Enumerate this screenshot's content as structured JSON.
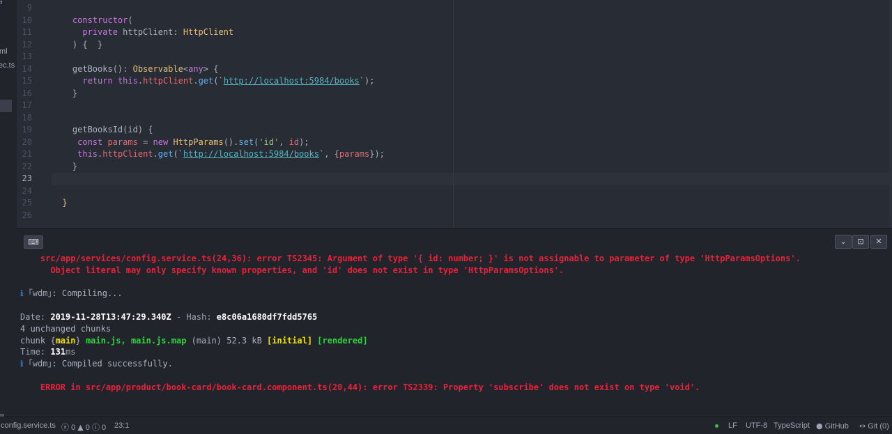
{
  "tree": {
    "fragments": [
      "s",
      "ml",
      "ec.ts"
    ]
  },
  "editor": {
    "lines": [
      {
        "n": "9",
        "tokens": []
      },
      {
        "n": "10",
        "tokens": [
          [
            "    ",
            "pl"
          ],
          [
            "constructor",
            "kw"
          ],
          [
            "(",
            "pun"
          ]
        ]
      },
      {
        "n": "11",
        "tokens": [
          [
            "      ",
            "pl"
          ],
          [
            "private",
            "kw"
          ],
          [
            " httpClient",
            "pl"
          ],
          [
            ": ",
            "pun"
          ],
          [
            "HttpClient",
            "ty"
          ]
        ]
      },
      {
        "n": "12",
        "tokens": [
          [
            "    ) {  }",
            "pun"
          ]
        ]
      },
      {
        "n": "13",
        "tokens": []
      },
      {
        "n": "14",
        "tokens": [
          [
            "    getBooks",
            "pl"
          ],
          [
            "(): ",
            "pun"
          ],
          [
            "Observable",
            "ty"
          ],
          [
            "<",
            "pun"
          ],
          [
            "any",
            "kw"
          ],
          [
            "> {",
            "pun"
          ]
        ]
      },
      {
        "n": "15",
        "tokens": [
          [
            "      ",
            "pl"
          ],
          [
            "return",
            "kw"
          ],
          [
            " ",
            "pl"
          ],
          [
            "this",
            "kw"
          ],
          [
            ".",
            "pun"
          ],
          [
            "httpClient",
            "prm"
          ],
          [
            ".",
            "pun"
          ],
          [
            "get",
            "fn"
          ],
          [
            "(`",
            "pun"
          ],
          [
            "http://localhost:5984/books",
            "url"
          ],
          [
            "`);",
            "pun"
          ]
        ]
      },
      {
        "n": "16",
        "tokens": [
          [
            "    }",
            "pun"
          ]
        ]
      },
      {
        "n": "17",
        "tokens": []
      },
      {
        "n": "18",
        "tokens": []
      },
      {
        "n": "19",
        "tokens": [
          [
            "    getBooksId",
            "pl"
          ],
          [
            "(id) {",
            "pun"
          ]
        ]
      },
      {
        "n": "20",
        "tokens": [
          [
            "     ",
            "pl"
          ],
          [
            "const",
            "kw"
          ],
          [
            " ",
            "pl"
          ],
          [
            "params",
            "prm"
          ],
          [
            " = ",
            "pun"
          ],
          [
            "new",
            "kw"
          ],
          [
            " ",
            "pl"
          ],
          [
            "HttpParams",
            "ty"
          ],
          [
            "().",
            "pun"
          ],
          [
            "set",
            "fn"
          ],
          [
            "(",
            "pun"
          ],
          [
            "'id'",
            "str"
          ],
          [
            ", ",
            "pun"
          ],
          [
            "id",
            "prm"
          ],
          [
            ");",
            "pun"
          ]
        ]
      },
      {
        "n": "21",
        "tokens": [
          [
            "     ",
            "pl"
          ],
          [
            "this",
            "kw"
          ],
          [
            ".",
            "pun"
          ],
          [
            "httpClient",
            "prm"
          ],
          [
            ".",
            "pun"
          ],
          [
            "get",
            "fn"
          ],
          [
            "(`",
            "pun"
          ],
          [
            "http://localhost:5984/books",
            "url"
          ],
          [
            "`, {",
            "pun"
          ],
          [
            "params",
            "prm"
          ],
          [
            "});",
            "pun"
          ]
        ]
      },
      {
        "n": "22",
        "tokens": [
          [
            "    }",
            "pun"
          ]
        ]
      },
      {
        "n": "23",
        "tokens": [],
        "current": true
      },
      {
        "n": "24",
        "tokens": []
      },
      {
        "n": "25",
        "tokens": [
          [
            "  }",
            "ty"
          ]
        ]
      },
      {
        "n": "26",
        "tokens": []
      }
    ]
  },
  "terminal": {
    "buttons": {
      "keyboard": "⌨",
      "collapse": "⌄",
      "maximize": "⊡",
      "close": "✕"
    },
    "lines": [
      [
        [
          "    src/app/services/config.service.ts(24,36): error TS2345: Argument of type '{ id: number; }' is not assignable to parameter of type 'HttpParamsOptions'.",
          "err"
        ]
      ],
      [
        [
          "      Object literal may only specify known properties, and 'id' does not exist in type 'HttpParamsOptions'.",
          "err"
        ]
      ],
      [],
      [
        [
          "ℹ",
          "blu"
        ],
        [
          " ｢wdm｣",
          "dim"
        ],
        [
          ": Compiling...",
          "pl"
        ]
      ],
      [],
      [
        [
          "Date: ",
          "dim"
        ],
        [
          "2019-11-28T13:47:29.340Z",
          "bold"
        ],
        [
          " - Hash: ",
          "dim"
        ],
        [
          "e8c06a1680df7fdd5765",
          "bold"
        ]
      ],
      [
        [
          "4 unchanged chunks",
          "pl"
        ]
      ],
      [
        [
          "chunk {",
          "pl"
        ],
        [
          "main",
          "yel"
        ],
        [
          "} ",
          "pl"
        ],
        [
          "main.js, main.js.map",
          "grn"
        ],
        [
          " (main) 52.3 kB ",
          "pl"
        ],
        [
          "[initial]",
          "yel"
        ],
        [
          " ",
          "pl"
        ],
        [
          "[rendered]",
          "grn"
        ]
      ],
      [
        [
          "Time: ",
          "dim"
        ],
        [
          "131",
          "bold"
        ],
        [
          "ms",
          "dim"
        ]
      ],
      [
        [
          "ℹ",
          "blu"
        ],
        [
          " ｢wdm｣",
          "dim"
        ],
        [
          ": Compiled successfully.",
          "pl"
        ]
      ],
      [],
      [
        [
          "    ERROR in src/app/product/book-card/book-card.component.ts(20,44): error TS2339: Property 'subscribe' does not exist on type 'void'.",
          "err"
        ]
      ]
    ]
  },
  "status": {
    "file": "config.service.ts",
    "errors": "0",
    "warnings": "0",
    "infos": "0",
    "cursor": "23:1",
    "line_ending": "LF",
    "encoding": "UTF-8",
    "grammar": "TypeScript",
    "github": "GitHub",
    "git": "Git (0)",
    "icons": {
      "error": "ⓧ",
      "warning": "▲",
      "info": "ⓘ",
      "github": "●",
      "git": "↔"
    }
  },
  "colors": {
    "editor_bg": "#282c34",
    "panel_bg": "#21252b",
    "error": "#e8213a",
    "keyword": "#c678dd",
    "type": "#e5c07b",
    "string": "#98c379",
    "url": "#56b6c2"
  }
}
